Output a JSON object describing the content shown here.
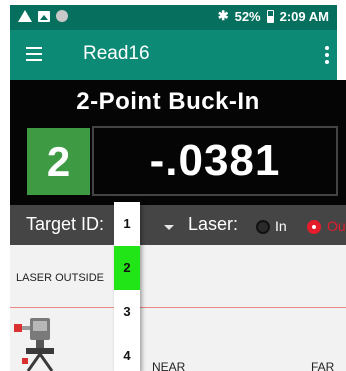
{
  "status_bar": {
    "icons": [
      "warning-icon",
      "image-icon",
      "circle-icon"
    ],
    "bluetooth_icon": "bluetooth-icon",
    "battery_percent": "52%",
    "battery_level": 0.52,
    "time": "2:09 AM"
  },
  "app_bar": {
    "title": "Read16",
    "menu_icon": "hamburger-menu-icon",
    "overflow_icon": "more-vertical-icon",
    "color": "#0d8a76"
  },
  "measurement": {
    "mode_title": "2-Point Buck-In",
    "target_id": "2",
    "reading": "-.0381",
    "target_color": "#3e9b44"
  },
  "controls": {
    "target_id_label": "Target ID:",
    "laser_label": "Laser:",
    "laser_options": [
      "In",
      "Out"
    ],
    "laser_selected": "Out",
    "accent_color": "#e51c2b"
  },
  "diagram": {
    "laser_outside_label": "LASER OUTSIDE",
    "near_label": "NEAR",
    "far_label": "FAR"
  },
  "dropdown": {
    "options": [
      "1",
      "2",
      "3",
      "4"
    ],
    "selected": "2",
    "selected_color": "#22e518"
  }
}
